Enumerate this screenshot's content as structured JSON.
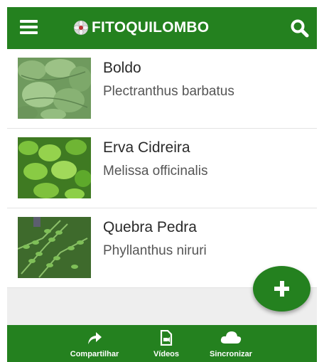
{
  "app_title": "FITOQUILOMBO",
  "icons": {
    "menu": "hamburger-icon",
    "logo": "flower-logo-icon",
    "search": "search-icon",
    "add": "plus-icon",
    "share": "share-arrow-icon",
    "videos": "video-file-icon",
    "sync": "cloud-icon"
  },
  "colors": {
    "primary": "#24811f",
    "background": "#ffffff",
    "empty_area": "#eeeeee"
  },
  "plants": [
    {
      "name": "Boldo",
      "scientific": "Plectranthus barbatus"
    },
    {
      "name": "Erva Cidreira",
      "scientific": "Melissa officinalis"
    },
    {
      "name": "Quebra Pedra",
      "scientific": "Phyllanthus niruri"
    }
  ],
  "bottom_nav": [
    {
      "label": "Compartilhar"
    },
    {
      "label": "Vídeos"
    },
    {
      "label": "Sincronizar"
    }
  ]
}
